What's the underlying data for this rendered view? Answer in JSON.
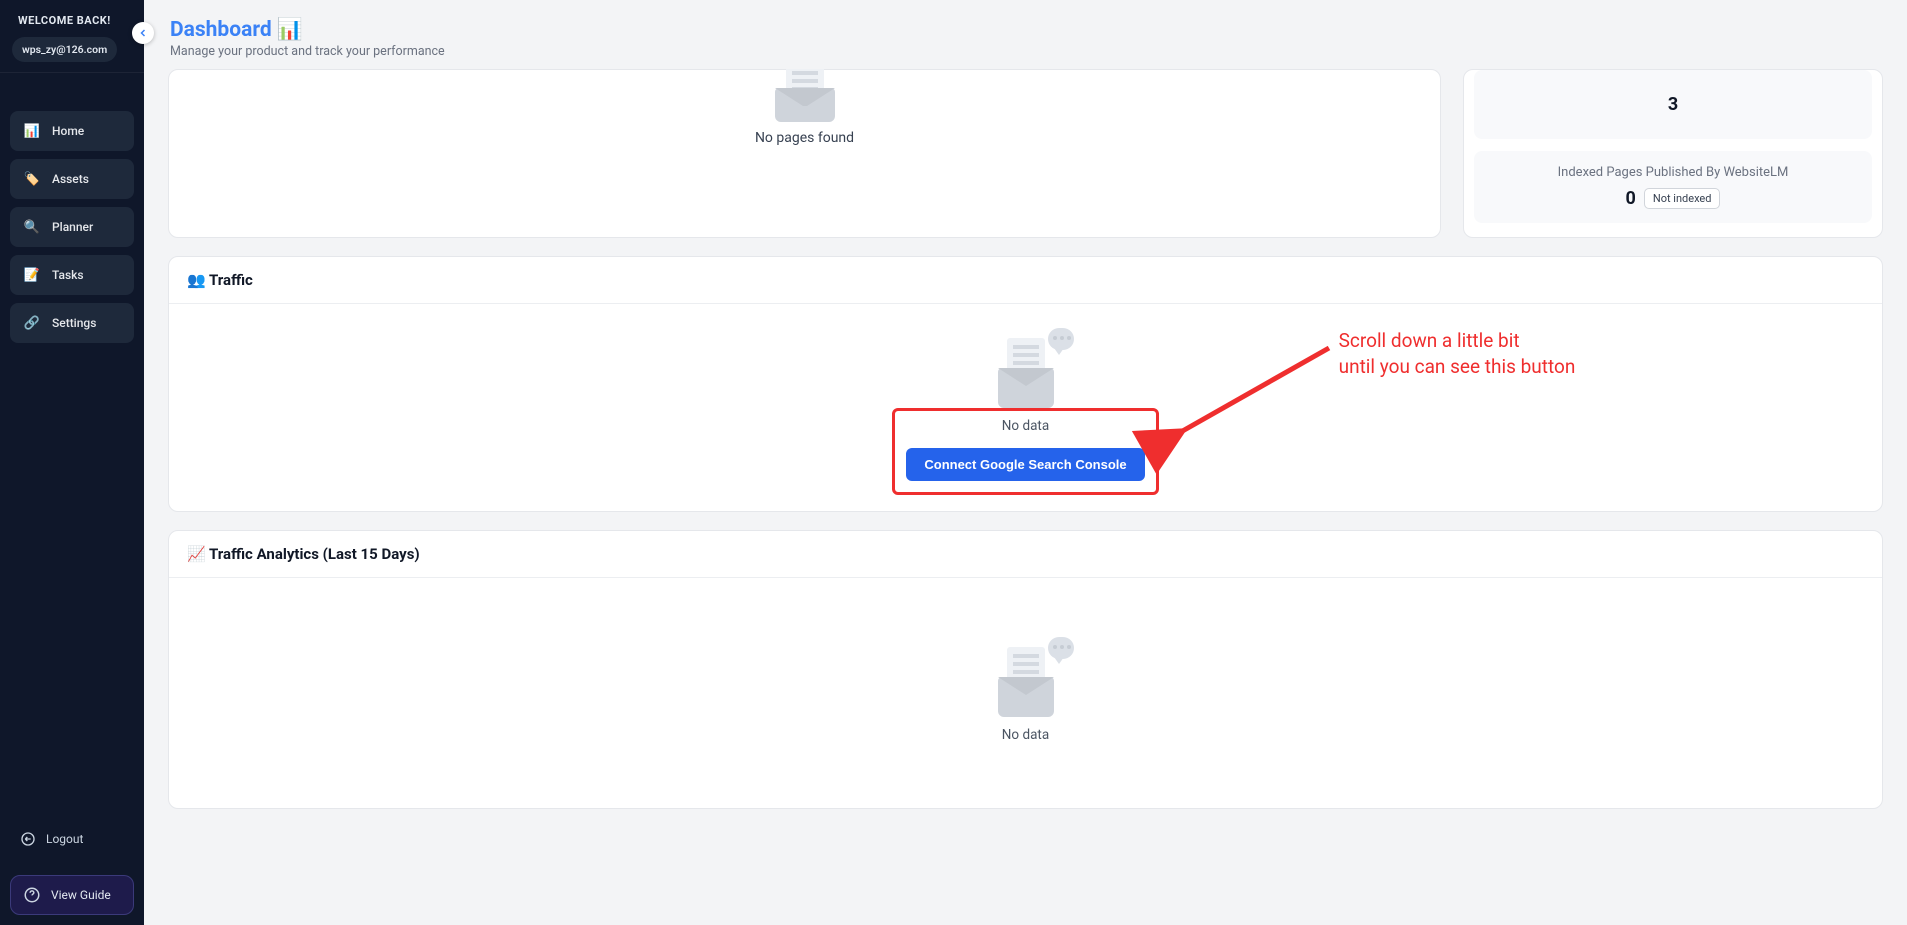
{
  "sidebar": {
    "welcome": "WELCOME BACK!",
    "user": "wps_zy@126.com",
    "items": [
      {
        "icon": "📊",
        "label": "Home"
      },
      {
        "icon": "🏷️",
        "label": "Assets"
      },
      {
        "icon": "🔍",
        "label": "Planner"
      },
      {
        "icon": "📝",
        "label": "Tasks"
      },
      {
        "icon": "🔗",
        "label": "Settings"
      }
    ],
    "logout": "Logout",
    "view_guide": "View Guide"
  },
  "header": {
    "title": "Dashboard 📊",
    "subtitle": "Manage your product and track your performance"
  },
  "top": {
    "no_pages": "No pages found",
    "stat1_value": "3",
    "stat2_label": "Indexed Pages Published By WebsiteLM",
    "stat2_value": "0",
    "stat2_badge": "Not indexed"
  },
  "traffic": {
    "title": "👥 Traffic",
    "no_data": "No data",
    "connect": "Connect Google Search Console"
  },
  "analytics": {
    "title": "📈 Traffic Analytics (Last 15 Days)",
    "no_data": "No data"
  },
  "annotation": {
    "line1": "Scroll down a little bit",
    "line2": "until you can see this button"
  }
}
